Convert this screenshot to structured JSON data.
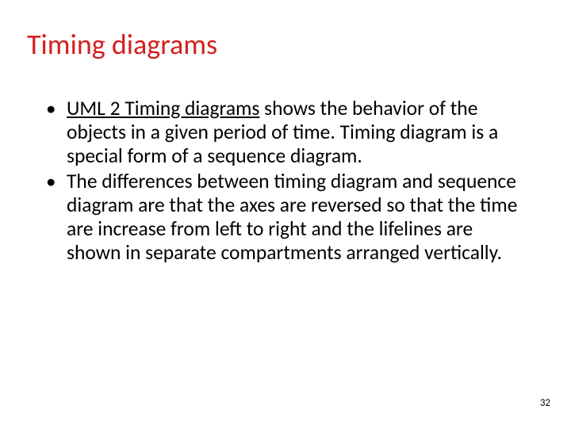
{
  "slide": {
    "title": "Timing diagrams",
    "bullets": [
      {
        "link": "UML 2 Timing diagrams",
        "rest": " shows the behavior of the objects in a given period of time. Timing diagram is a special form of a sequence diagram."
      },
      {
        "text": "The differences between timing diagram and sequence diagram are that the axes are reversed so that the time are increase from left to right and the lifelines are shown in separate compartments arranged vertically."
      }
    ],
    "page_number": "32"
  }
}
